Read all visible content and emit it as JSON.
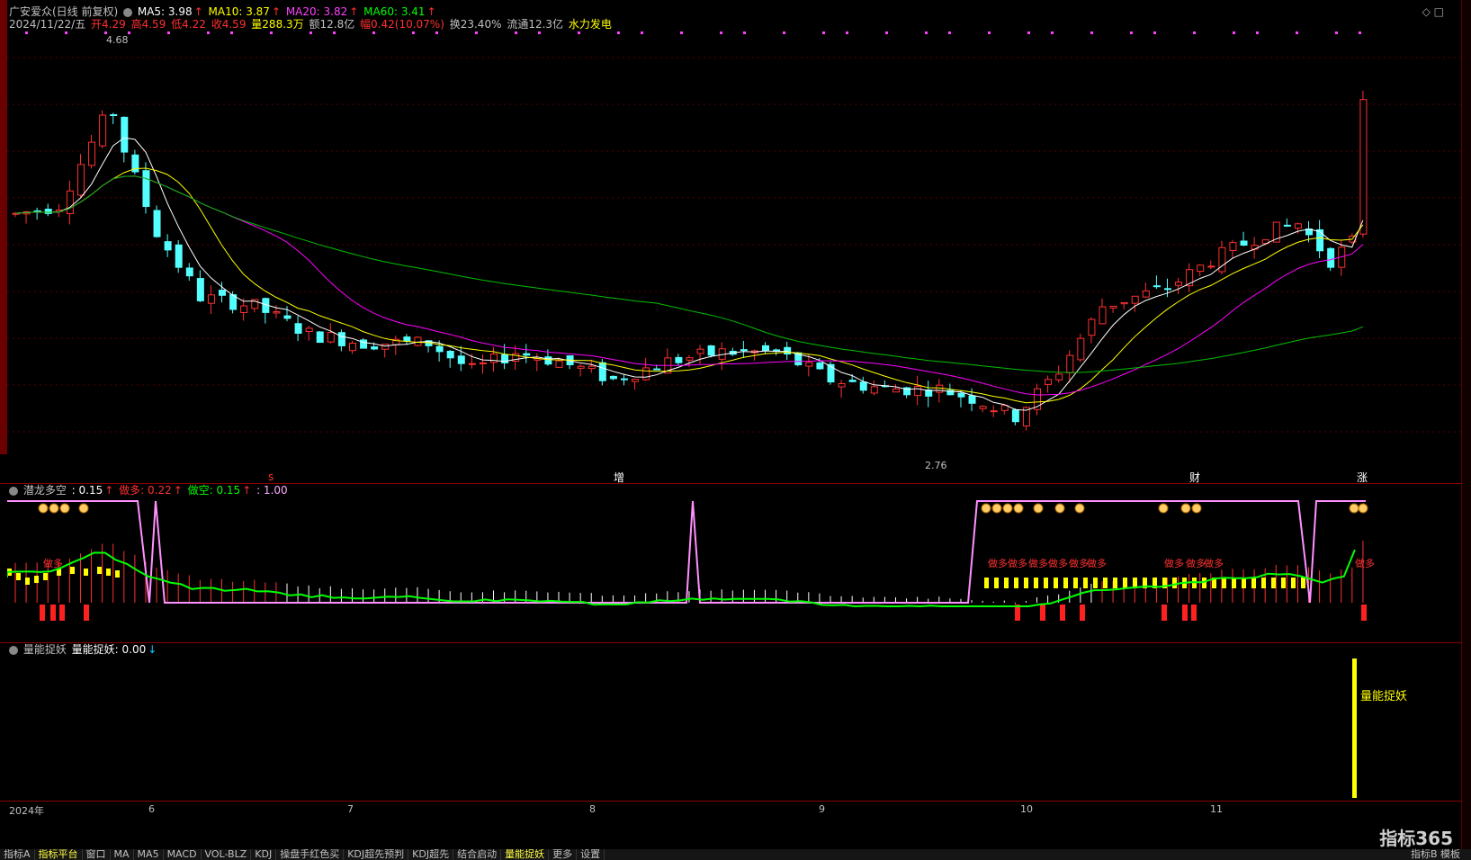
{
  "header": {
    "title": "广安爱众(日线 前复权)",
    "ma5": "MA5: 3.98",
    "ma10": "MA10: 3.87",
    "ma20": "MA20: 3.82",
    "ma60": "MA60: 3.41",
    "date": "2024/11/22/五",
    "open": "开4.29",
    "high": "高4.59",
    "low": "低4.22",
    "close": "收4.59",
    "volume": "量288.3万",
    "amount": "额12.8亿",
    "change": "幅0.42(10.07%)",
    "turnover": "换23.40%",
    "float": "流通12.3亿",
    "concept": "水力发电"
  },
  "price_marks": {
    "high_label": "4.68",
    "low_label": "2.76"
  },
  "event_labels": [
    "s",
    "增",
    "财",
    "涨"
  ],
  "panel2": {
    "title": "潜龙多空",
    "value": ": 0.15",
    "label_duo": "做多: 0.22",
    "label_kong": "做空: 0.15",
    "extra": ": 1.00",
    "zuoduo_text": "做多"
  },
  "panel3": {
    "title": "量能捉妖",
    "label": "量能捉妖: 0.00",
    "marker_text": "量能捉妖"
  },
  "xaxis": [
    "2024年",
    "6",
    "7",
    "8",
    "9",
    "10",
    "11"
  ],
  "tabs": [
    "指标A",
    "指标平台",
    "窗口",
    "MA",
    "MA5",
    "MACD",
    "VOL-BLZ",
    "KDJ",
    "操盘手红色买",
    "KDJ超先预判",
    "KDJ超先",
    "结合启动",
    "量能捉妖",
    "更多",
    "设置"
  ],
  "active_tab": "量能捉妖",
  "right_tabs": [
    "指标B",
    "模板"
  ],
  "logo": "指标365",
  "chart_data": {
    "type": "candlestick",
    "title": "广安爱众(日线 前复权)",
    "ylim": [
      2.6,
      4.9
    ],
    "series": [
      {
        "name": "MA5",
        "color": "#ffffff"
      },
      {
        "name": "MA10",
        "color": "#ffff00"
      },
      {
        "name": "MA20",
        "color": "#ff00ff"
      },
      {
        "name": "MA60",
        "color": "#00c000"
      }
    ],
    "price_high": 4.68,
    "price_low": 2.76,
    "last_close": 4.59
  }
}
